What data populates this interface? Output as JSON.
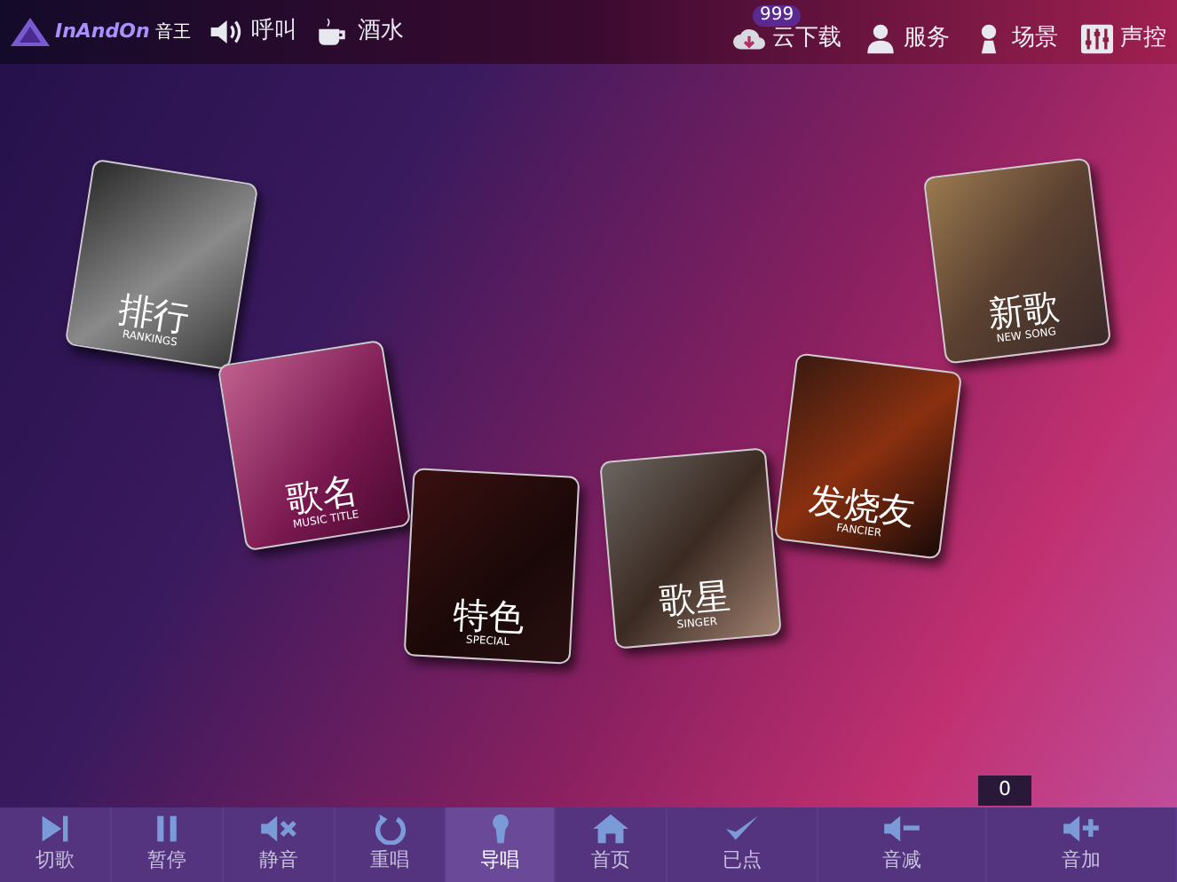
{
  "header": {
    "logo": {
      "brand": "InAndOn",
      "sub": "音王"
    },
    "left_items": [
      {
        "kind": "speaker",
        "label": "呼叫"
      },
      {
        "kind": "cup",
        "label": "酒水"
      }
    ],
    "right_items": [
      {
        "kind": "cloud",
        "label": "云下载",
        "badge": "999"
      },
      {
        "kind": "person",
        "label": "服务"
      },
      {
        "kind": "scene",
        "label": "场景"
      },
      {
        "kind": "mixer",
        "label": "声控"
      }
    ]
  },
  "tiles": [
    {
      "kind": "rankings",
      "title": "排行",
      "subtitle": "RANKINGS"
    },
    {
      "kind": "titles",
      "title": "歌名",
      "subtitle": "MUSIC TITLE"
    },
    {
      "kind": "special",
      "title": "特色",
      "subtitle": "SPECIAL"
    },
    {
      "kind": "singer",
      "title": "歌星",
      "subtitle": "SINGER"
    },
    {
      "kind": "fancier",
      "title": "发烧友",
      "subtitle": "FANCIER"
    },
    {
      "kind": "new",
      "title": "新歌",
      "subtitle": "NEW SONG"
    }
  ],
  "queue_count": "0",
  "toolbar": [
    {
      "kind": "next",
      "label": "切歌",
      "selected": false
    },
    {
      "kind": "pause",
      "label": "暂停",
      "selected": false
    },
    {
      "kind": "mute",
      "label": "静音",
      "selected": false
    },
    {
      "kind": "replay",
      "label": "重唱",
      "selected": false
    },
    {
      "kind": "guide",
      "label": "导唱",
      "selected": true
    },
    {
      "kind": "home",
      "label": "首页",
      "selected": false
    },
    {
      "kind": "ordered",
      "label": "已点",
      "selected": false
    },
    {
      "kind": "voldown",
      "label": "音减",
      "selected": false
    },
    {
      "kind": "volup",
      "label": "音加",
      "selected": false
    }
  ]
}
